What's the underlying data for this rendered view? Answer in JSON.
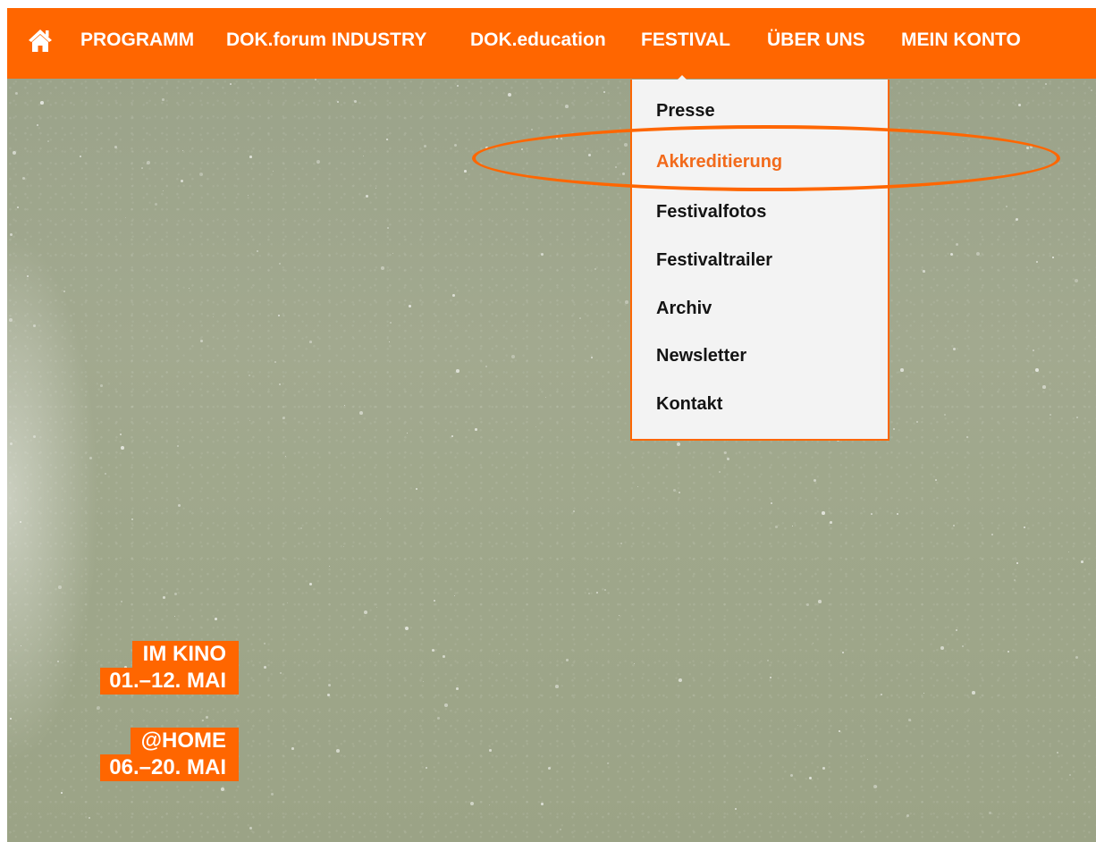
{
  "colors": {
    "accent": "#FF6600",
    "active_item": "#F26A1B",
    "dropdown_bg": "#F3F3F3",
    "nav_text": "#FFFFFF",
    "hero_bg": "#9FA78B"
  },
  "nav": {
    "home_icon": "home-icon",
    "items": [
      {
        "label": "PROGRAMM"
      },
      {
        "label": "DOK.forum INDUSTRY"
      },
      {
        "label": "DOK.education"
      },
      {
        "label": "FESTIVAL"
      },
      {
        "label": "ÜBER UNS"
      },
      {
        "label": "MEIN KONTO"
      }
    ]
  },
  "dropdown": {
    "items": [
      {
        "label": "Presse"
      },
      {
        "label": "Akkreditierung"
      },
      {
        "label": "Festivalfotos"
      },
      {
        "label": "Festivaltrailer"
      },
      {
        "label": "Archiv"
      },
      {
        "label": "Newsletter"
      },
      {
        "label": "Kontakt"
      }
    ],
    "active_label": "Akkreditierung"
  },
  "badges": {
    "kino_line1": "IM KINO",
    "kino_line2": "01.–12. MAI",
    "home_line1": "@HOME",
    "home_line2": "06.–20. MAI"
  }
}
